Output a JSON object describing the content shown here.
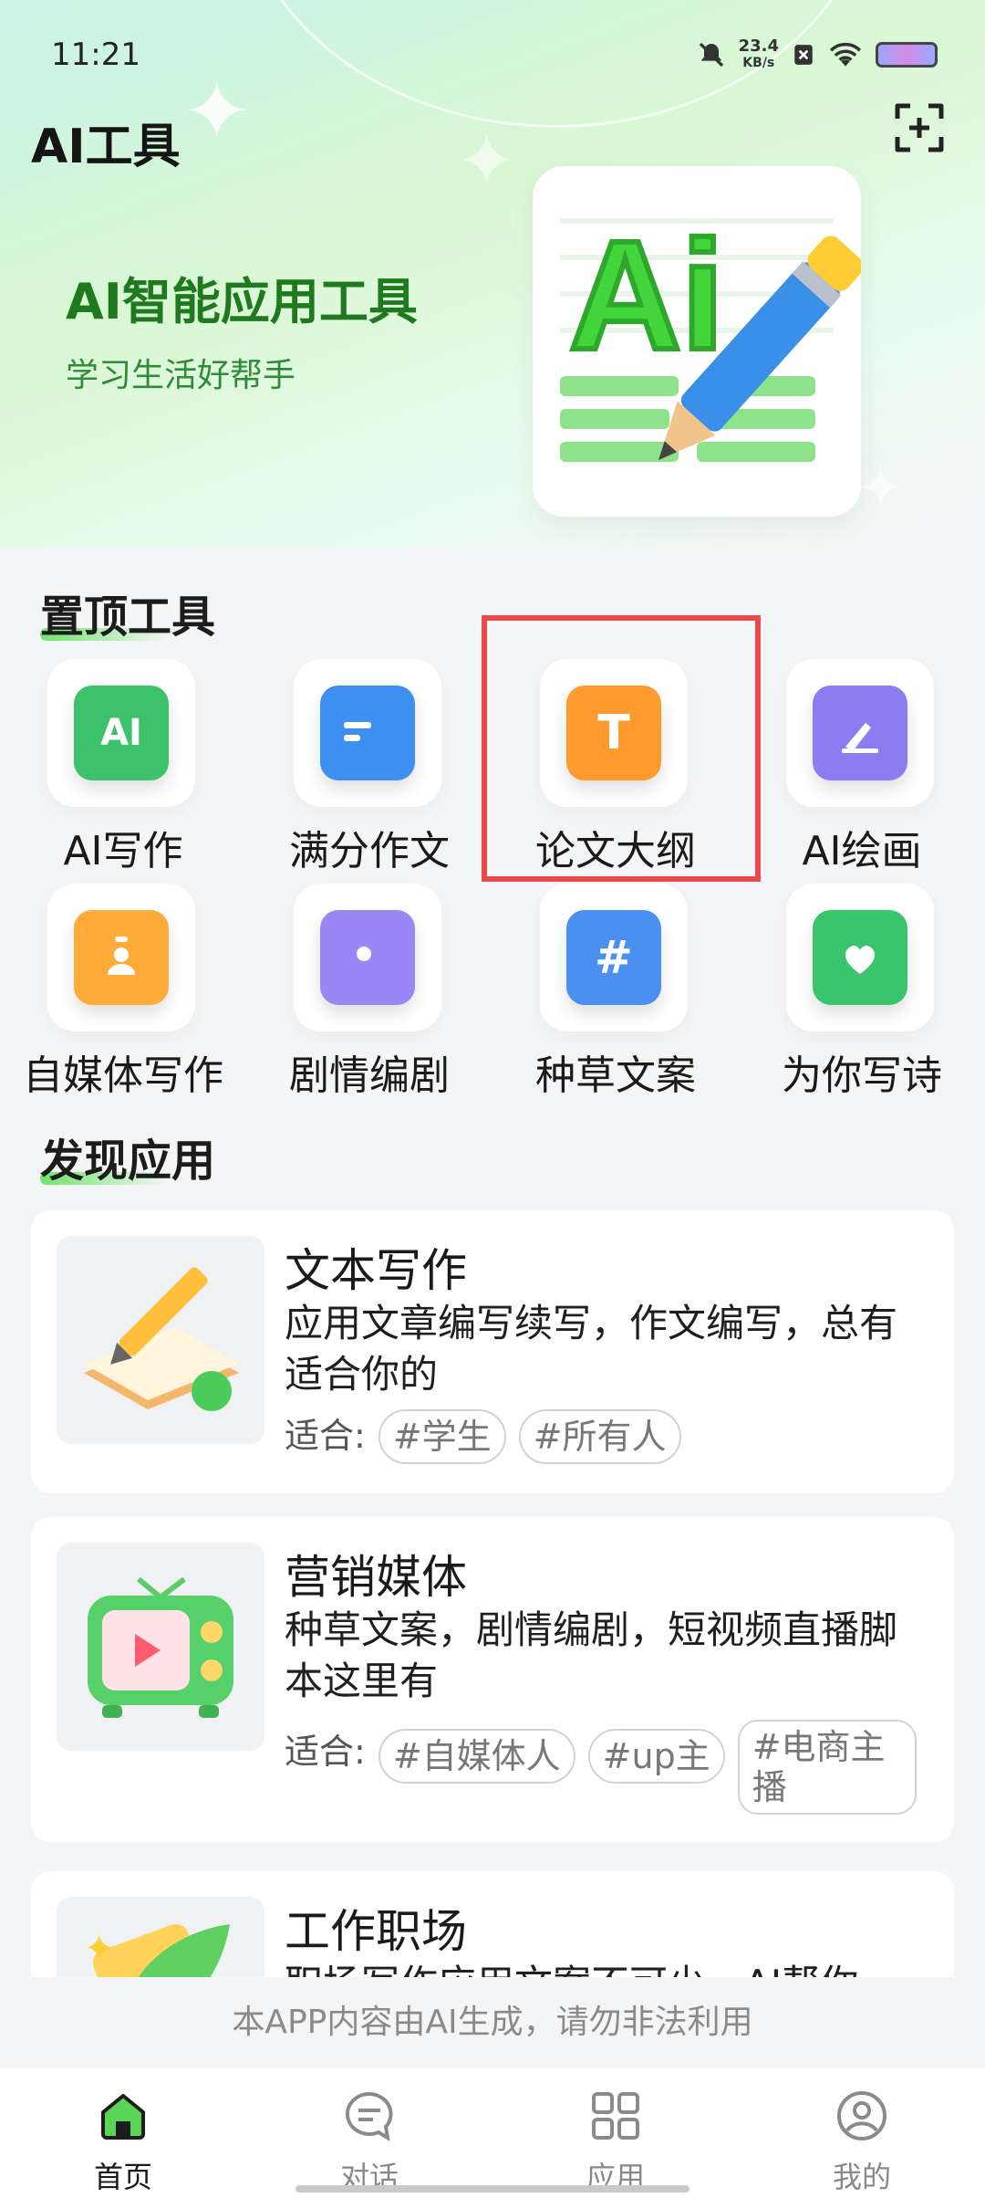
{
  "status": {
    "time": "11:21",
    "speed_value": "23.4",
    "speed_unit": "KB/s"
  },
  "header": {
    "title": "AI工具"
  },
  "hero": {
    "title": "AI智能应用工具",
    "subtitle": "学习生活好帮手",
    "art_text": "Ai"
  },
  "pinned": {
    "title": "置顶工具",
    "items": [
      {
        "label": "AI写作",
        "icon": "ai-icon",
        "glyph": "AI",
        "color": "#3cc26b"
      },
      {
        "label": "满分作文",
        "icon": "book-icon",
        "glyph": "",
        "color": "#3d8ff2"
      },
      {
        "label": "论文大纲",
        "icon": "text-t-icon",
        "glyph": "T",
        "color": "#ff9a2e"
      },
      {
        "label": "AI绘画",
        "icon": "paint-brush-icon",
        "glyph": "",
        "color": "#8c7cf2"
      },
      {
        "label": "自媒体写作",
        "icon": "person-card-icon",
        "glyph": "",
        "color": "#ffab3a"
      },
      {
        "label": "剧情编剧",
        "icon": "video-camera-icon",
        "glyph": "",
        "color": "#9a86f5"
      },
      {
        "label": "种草文案",
        "icon": "hashtag-icon",
        "glyph": "#",
        "color": "#4b8ff0"
      },
      {
        "label": "为你写诗",
        "icon": "heart-envelope-icon",
        "glyph": "",
        "color": "#38c56c"
      }
    ]
  },
  "discover": {
    "title": "发现应用",
    "fit_label": "适合:",
    "cards": [
      {
        "title": "文本写作",
        "desc": "应用文章编写续写，作文编写，总有适合你的",
        "tags": [
          "#学生",
          "#所有人"
        ],
        "icon": "writing-pen-icon"
      },
      {
        "title": "营销媒体",
        "desc": "种草文案，剧情编剧，短视频直播脚本这里有",
        "tags": [
          "#自媒体人",
          "#up主",
          "#电商主播"
        ],
        "icon": "retro-tv-icon"
      },
      {
        "title": "工作职场",
        "desc": "职场写作应用文案不可少，AI帮你",
        "tags": [],
        "icon": "feather-icon"
      }
    ]
  },
  "footer_note": "本APP内容由AI生成，请勿非法利用",
  "tabbar": [
    {
      "label": "首页",
      "icon": "home-icon",
      "active": true
    },
    {
      "label": "对话",
      "icon": "chat-icon",
      "active": false
    },
    {
      "label": "应用",
      "icon": "grid-icon",
      "active": false
    },
    {
      "label": "我的",
      "icon": "profile-icon",
      "active": false
    }
  ]
}
